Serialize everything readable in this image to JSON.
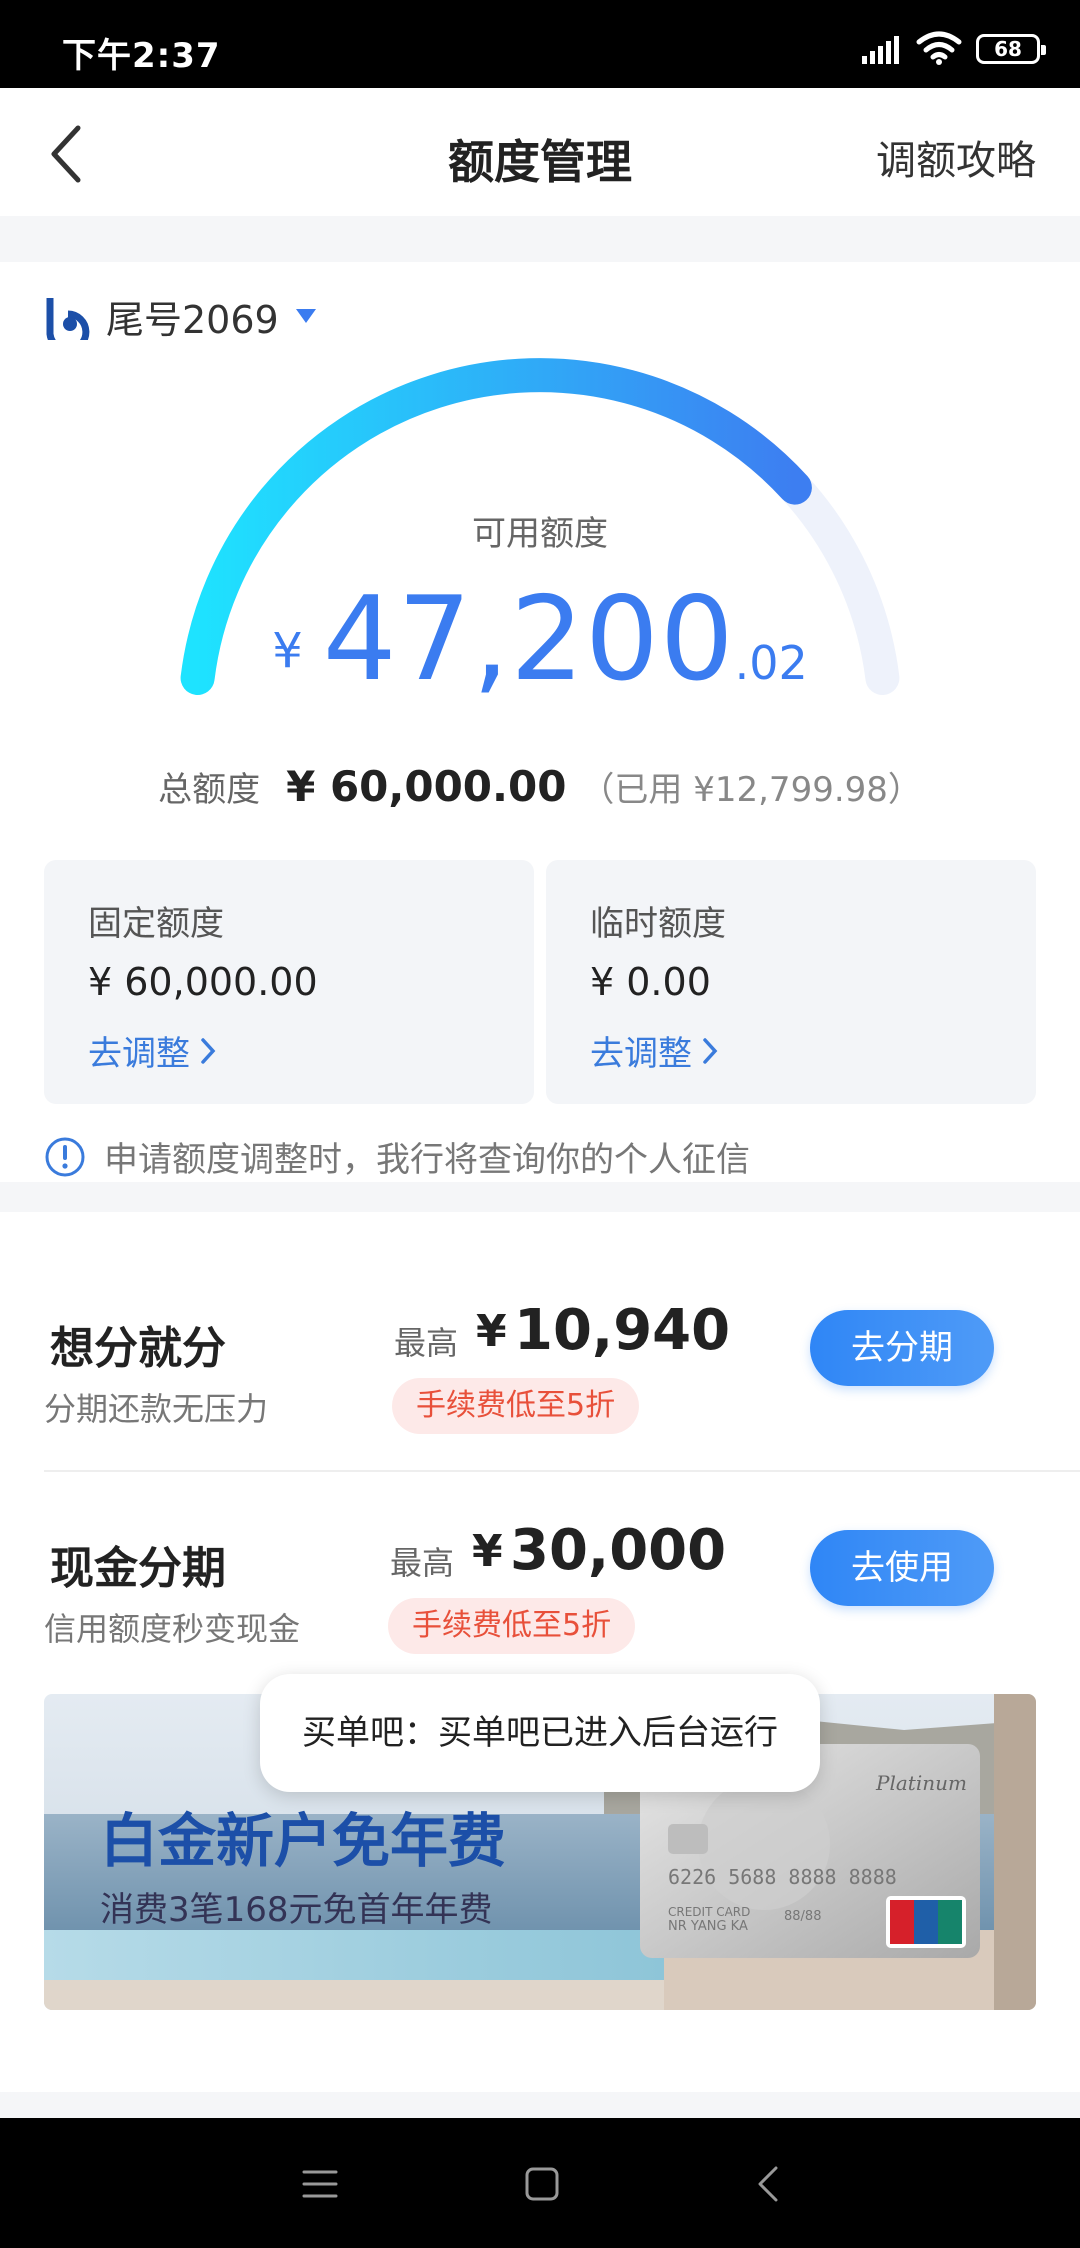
{
  "status_bar": {
    "time": "下午2:37",
    "battery": "68"
  },
  "nav": {
    "title": "额度管理",
    "right_link": "调额攻略"
  },
  "card": {
    "label": "尾号2069"
  },
  "gauge": {
    "label": "可用额度",
    "currency": "¥",
    "amount_int": "47,200",
    "amount_dec": ".02",
    "used_fraction": 0.787
  },
  "total": {
    "label": "总额度",
    "value": "¥ 60,000.00",
    "used": "（已用 ¥12,799.98）"
  },
  "fixed": {
    "title": "固定额度",
    "value": "¥ 60,000.00",
    "link": "去调整"
  },
  "temp": {
    "title": "临时额度",
    "value": "¥ 0.00",
    "link": "去调整"
  },
  "notice": "申请额度调整时，我行将查询你的个人征信",
  "promos": [
    {
      "title": "想分就分",
      "subtitle": "分期还款无压力",
      "max_label": "最高",
      "currency": "¥",
      "max_value": "10,940",
      "tag": "手续费低至5折",
      "button": "去分期"
    },
    {
      "title": "现金分期",
      "subtitle": "信用额度秒变现金",
      "max_label": "最高",
      "currency": "¥",
      "max_value": "30,000",
      "tag": "手续费低至5折",
      "button": "去使用"
    }
  ],
  "banner": {
    "title": "白金新户免年费",
    "subtitle": "消费3笔168元免首年年费"
  },
  "toast": "买单吧：买单吧已进入后台运行",
  "colors": {
    "accent": "#3b7cf0",
    "tag_red": "#e8503a",
    "button_blue": "#2f86f6"
  }
}
